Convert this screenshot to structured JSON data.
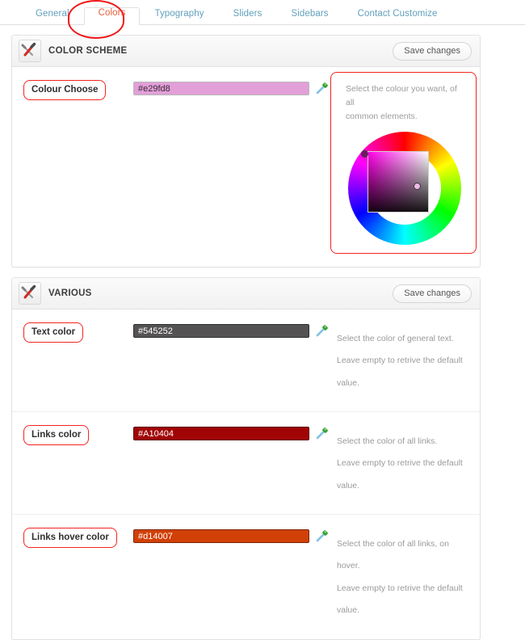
{
  "tabs": [
    {
      "label": "General",
      "active": false
    },
    {
      "label": "Colors",
      "active": true
    },
    {
      "label": "Typography",
      "active": false
    },
    {
      "label": "Sliders",
      "active": false
    },
    {
      "label": "Sidebars",
      "active": false
    },
    {
      "label": "Contact Customize",
      "active": false
    }
  ],
  "colors": {
    "accent_tab_active": "#e8603c",
    "tab_inactive": "#62a0bd",
    "annotation_red": "#f3251f"
  },
  "panels": {
    "color_scheme": {
      "title": "COLOR SCHEME",
      "save_label": "Save changes",
      "icon": "tools-icon",
      "row": {
        "label": "Colour Choose",
        "value": "#e29fd8",
        "swatch": "#e29fd8",
        "text_color": "#3a2b36",
        "description_line1": "Select the colour you want, of all",
        "description_line2": "common elements.",
        "picker_icon": "eyedropper-icon"
      },
      "wheel": {
        "selected_hue_hex": "#e29fd8",
        "marker_ring_color": "#7a1370",
        "marker_sv_color": "#f0b8e8"
      }
    },
    "various": {
      "title": "VARIOUS",
      "save_label": "Save changes",
      "icon": "tools-icon",
      "rows": [
        {
          "label": "Text color",
          "value": "#545252",
          "swatch": "#545252",
          "text_color": "#ffffff",
          "description": [
            "Select the color of general text.",
            "Leave empty to retrive the default",
            "value."
          ],
          "picker_icon": "eyedropper-icon"
        },
        {
          "label": "Links color",
          "value": "#A10404",
          "swatch": "#a10404",
          "text_color": "#ffffff",
          "description": [
            "Select the color of all links.",
            "Leave empty to retrive the default",
            "value."
          ],
          "picker_icon": "eyedropper-icon"
        },
        {
          "label": "Links hover color",
          "value": "#d14007",
          "swatch": "#d14007",
          "text_color": "#ffffff",
          "description": [
            "Select the color of all links, on",
            "hover.",
            "Leave empty to retrive the default",
            "value."
          ],
          "picker_icon": "eyedropper-icon"
        }
      ]
    }
  }
}
